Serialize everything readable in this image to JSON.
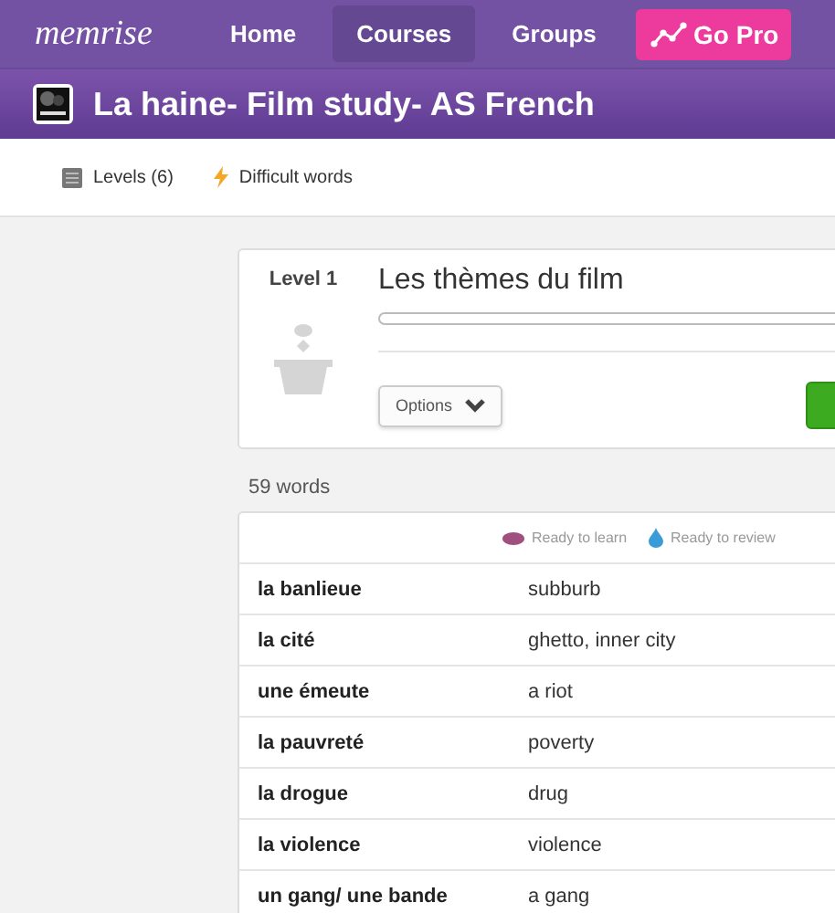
{
  "nav": {
    "logo": "memrise",
    "items": [
      {
        "label": "Home",
        "selected": false
      },
      {
        "label": "Courses",
        "selected": true
      },
      {
        "label": "Groups",
        "selected": false
      }
    ],
    "pro_button": "Go Pro"
  },
  "course": {
    "title": "La haine- Film study- AS French"
  },
  "tabs": [
    {
      "kind": "levels",
      "label": "Levels (6)"
    },
    {
      "kind": "difficult",
      "label": "Difficult words"
    }
  ],
  "level": {
    "label": "Level 1",
    "title": "Les thèmes du film",
    "options_button": "Options"
  },
  "word_count": "59 words",
  "legend": [
    {
      "kind": "learn",
      "label": "Ready to learn"
    },
    {
      "kind": "review",
      "label": "Ready to review"
    }
  ],
  "words": [
    {
      "term": "la banlieue",
      "definition": "subburb"
    },
    {
      "term": "la cité",
      "definition": "ghetto, inner city"
    },
    {
      "term": "une émeute",
      "definition": "a riot"
    },
    {
      "term": "la pauvreté",
      "definition": "poverty"
    },
    {
      "term": "la drogue",
      "definition": "drug"
    },
    {
      "term": "la violence",
      "definition": "violence"
    },
    {
      "term": "un gang/ une bande",
      "definition": "a gang"
    }
  ]
}
